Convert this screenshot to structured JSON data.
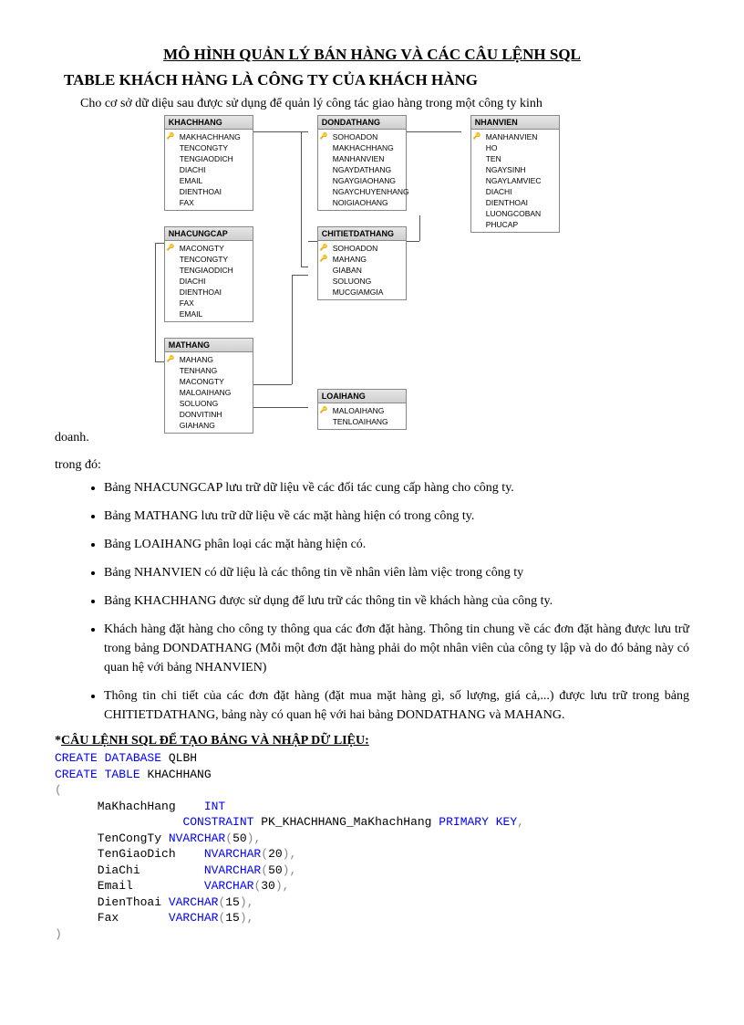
{
  "title": "MÔ HÌNH QUẢN LÝ BÁN HÀNG VÀ CÁC CÂU LỆNH SQL",
  "subtitle": "TABLE KHÁCH HÀNG LÀ CÔNG TY CỦA KHÁCH HÀNG",
  "intro_line1": "Cho cơ sở dữ diệu sau được sử dụng để quản lý công tác giao hàng trong một công ty kinh",
  "intro_line2": "doanh.",
  "trongdo": "trong đó:",
  "tables": {
    "khachhang": {
      "title": "KHACHHANG",
      "cols": [
        "MAKHACHHANG",
        "TENCONGTY",
        "TENGIAODICH",
        "DIACHI",
        "EMAIL",
        "DIENTHOAI",
        "FAX"
      ],
      "pk": [
        0
      ]
    },
    "dondathang": {
      "title": "DONDATHANG",
      "cols": [
        "SOHOADON",
        "MAKHACHHANG",
        "MANHANVIEN",
        "NGAYDATHANG",
        "NGAYGIAOHANG",
        "NGAYCHUYENHANG",
        "NOIGIAOHANG"
      ],
      "pk": [
        0
      ]
    },
    "nhanvien": {
      "title": "NHANVIEN",
      "cols": [
        "MANHANVIEN",
        "HO",
        "TEN",
        "NGAYSINH",
        "NGAYLAMVIEC",
        "DIACHI",
        "DIENTHOAI",
        "LUONGCOBAN",
        "PHUCAP"
      ],
      "pk": [
        0
      ]
    },
    "nhacungcap": {
      "title": "NHACUNGCAP",
      "cols": [
        "MACONGTY",
        "TENCONGTY",
        "TENGIAODICH",
        "DIACHI",
        "DIENTHOAI",
        "FAX",
        "EMAIL"
      ],
      "pk": [
        0
      ]
    },
    "chitietdathang": {
      "title": "CHITIETDATHANG",
      "cols": [
        "SOHOADON",
        "MAHANG",
        "GIABAN",
        "SOLUONG",
        "MUCGIAMGIA"
      ],
      "pk": [
        0,
        1
      ]
    },
    "mathang": {
      "title": "MATHANG",
      "cols": [
        "MAHANG",
        "TENHANG",
        "MACONGTY",
        "MALOAIHANG",
        "SOLUONG",
        "DONVITINH",
        "GIAHANG"
      ],
      "pk": [
        0
      ]
    },
    "loaihang": {
      "title": "LOAIHANG",
      "cols": [
        "MALOAIHANG",
        "TENLOAIHANG"
      ],
      "pk": [
        0
      ]
    }
  },
  "bullets": [
    "Bảng NHACUNGCAP  lưu trữ dữ liệu về các đối tác cung cấp hàng cho công ty.",
    "Bảng MATHANG  lưu trữ dữ liệu về các mặt hàng hiện có trong công ty.",
    "Bảng LOAIHANG  phân loại các mặt hàng hiện có.",
    "Bảng NHANVIEN  có dữ liệu là các thông tin về nhân viên làm việc trong công ty",
    "Bảng KHACHHANG  được sử dụng để lưu trữ các thông tin về khách hàng của công ty.",
    "Khách hàng đặt hàng cho công ty thông qua các đơn đặt hàng. Thông tin chung về các đơn đặt hàng được lưu trữ trong bảng DONDATHANG  (Mỗi một đơn đặt hàng phải do một nhân viên của công ty lập và do đó bảng này có quan hệ với bảng NHANVIEN)",
    "Thông tin chi tiết của các đơn đặt hàng (đặt mua mặt hàng gì, số lượng, giá cả,...) được lưu trữ trong bảng CHITIETDATHANG,  bảng này có quan hệ với hai bảng DONDATHANG  và MAHANG."
  ],
  "section_head_prefix": "*",
  "section_head": "CÂU LỆNH SQL ĐỂ TẠO BẢNG VÀ NHẬP DỮ LIỆU:",
  "sql": {
    "l1a": "CREATE",
    "l1b": "DATABASE",
    "l1c": " QLBH",
    "l2a": "CREATE",
    "l2b": "TABLE",
    "l2c": " KHACHHANG",
    "l3": "(",
    "l4a": "      MaKhachHang    ",
    "l4b": "INT",
    "l5a": "                  ",
    "l5b": "CONSTRAINT",
    "l5c": " PK_KHACHHANG_MaKhachHang ",
    "l5d": "PRIMARY",
    "l5e": "KEY",
    "l5f": ",",
    "l6a": "      TenCongTy ",
    "l6b": "NVARCHAR",
    "l6c": "(",
    "l6d": "50",
    "l6e": "),",
    "l7a": "      TenGiaoDich    ",
    "l7b": "NVARCHAR",
    "l7c": "(",
    "l7d": "20",
    "l7e": "),",
    "l8a": "      DiaChi         ",
    "l8b": "NVARCHAR",
    "l8c": "(",
    "l8d": "50",
    "l8e": "),",
    "l9a": "      Email          ",
    "l9b": "VARCHAR",
    "l9c": "(",
    "l9d": "30",
    "l9e": "),",
    "l10a": "      DienThoai ",
    "l10b": "VARCHAR",
    "l10c": "(",
    "l10d": "15",
    "l10e": "),",
    "l11a": "      Fax       ",
    "l11b": "VARCHAR",
    "l11c": "(",
    "l11d": "15",
    "l11e": "),",
    "l12": ")"
  }
}
